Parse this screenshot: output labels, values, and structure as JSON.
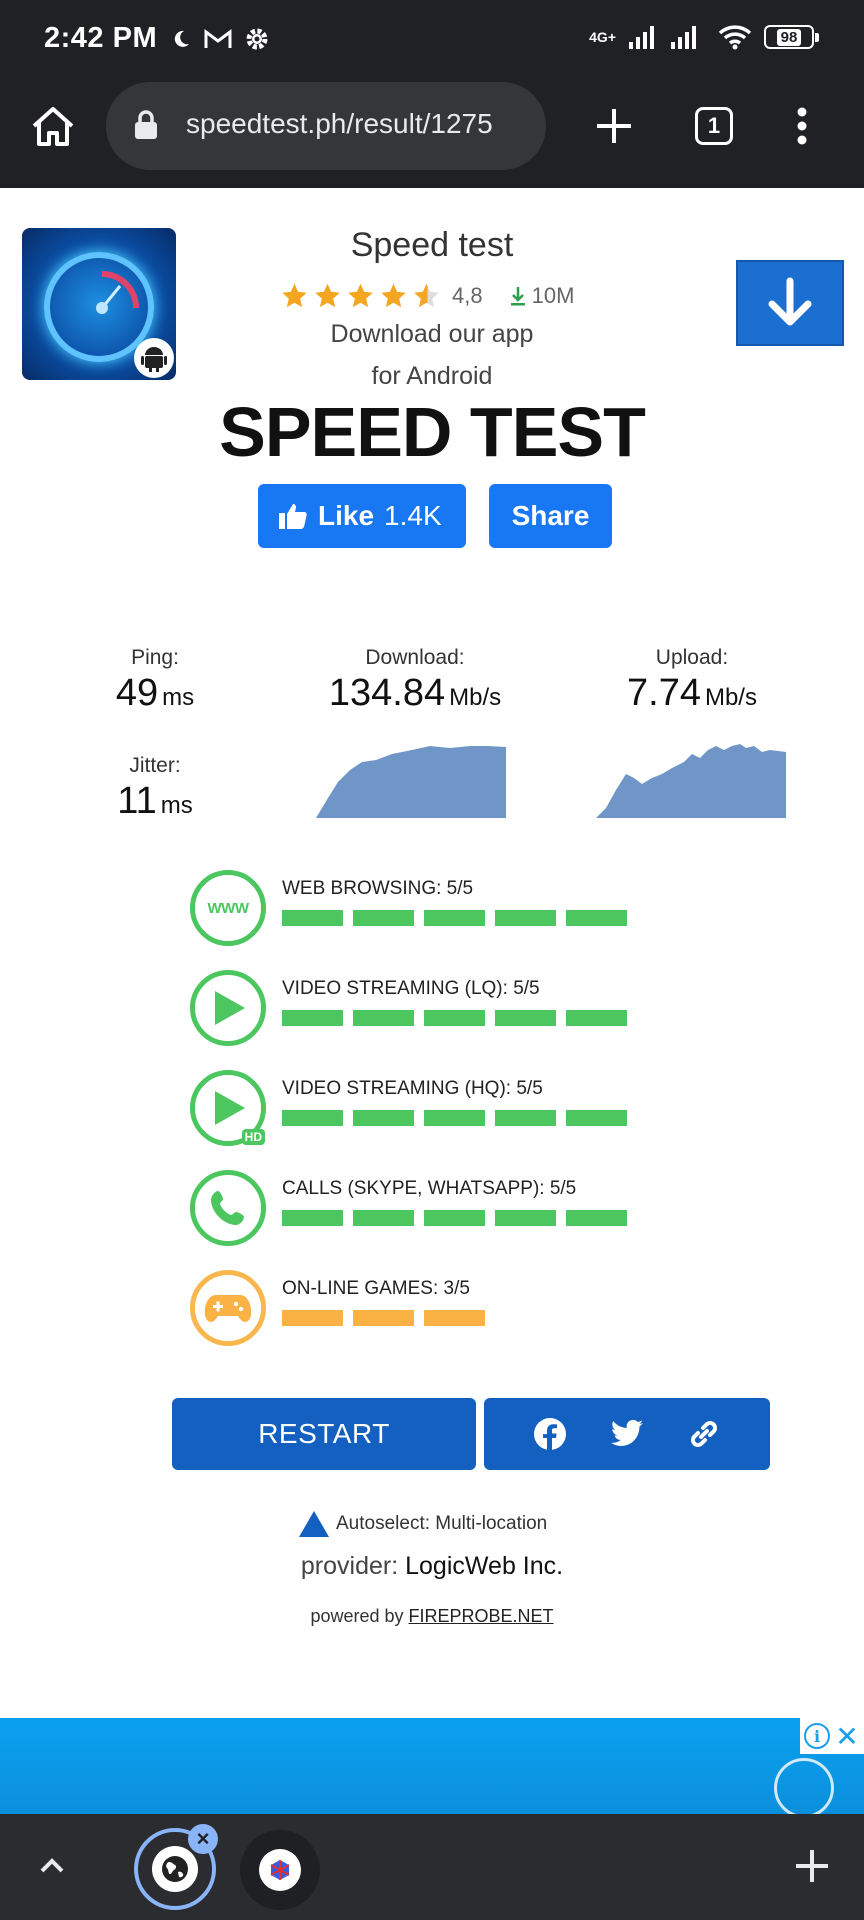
{
  "status_bar": {
    "time": "2:42 PM",
    "network": "4G+",
    "battery": "98"
  },
  "browser": {
    "url": "speedtest.ph/result/1275",
    "tab_count": "1"
  },
  "app_promo": {
    "title": "Speed test",
    "rating": "4,8",
    "downloads": "10M",
    "line1": "Download our app",
    "line2": "for Android",
    "stars": 4.5
  },
  "page": {
    "title": "SPEED TEST",
    "like_label": "Like",
    "like_count": "1.4K",
    "share_label": "Share"
  },
  "results": {
    "ping": {
      "label": "Ping:",
      "value": "49",
      "unit": "ms"
    },
    "jitter": {
      "label": "Jitter:",
      "value": "11",
      "unit": "ms"
    },
    "download": {
      "label": "Download:",
      "value": "134.84",
      "unit": "Mb/s"
    },
    "upload": {
      "label": "Upload:",
      "value": "7.74",
      "unit": "Mb/s"
    }
  },
  "quality": [
    {
      "label": "WEB BROWSING: 5/5",
      "score": 5,
      "color": "#4cc760"
    },
    {
      "label": "VIDEO STREAMING (LQ): 5/5",
      "score": 5,
      "color": "#4cc760"
    },
    {
      "label": "VIDEO STREAMING (HQ): 5/5",
      "score": 5,
      "color": "#4cc760"
    },
    {
      "label": "CALLS (SKYPE, WHATSAPP): 5/5",
      "score": 5,
      "color": "#4cc760"
    },
    {
      "label": "ON-LINE GAMES: 3/5",
      "score": 3,
      "color": "#fbb244"
    }
  ],
  "quality_icons": {
    "www_text": "WWW",
    "hd_text": "HD"
  },
  "actions": {
    "restart_label": "RESTART"
  },
  "footer": {
    "server": "Autoselect: Multi-location",
    "provider_prefix": "provider:",
    "provider_name": "LogicWeb Inc.",
    "powered_prefix": "powered by",
    "powered_link": "FIREPROBE.NET"
  },
  "colors": {
    "accent_blue": "#1460c0",
    "facebook_blue": "#1877f2",
    "good_green": "#4cc760",
    "warn_orange": "#fbb244",
    "graph_fill": "#7096c8"
  }
}
